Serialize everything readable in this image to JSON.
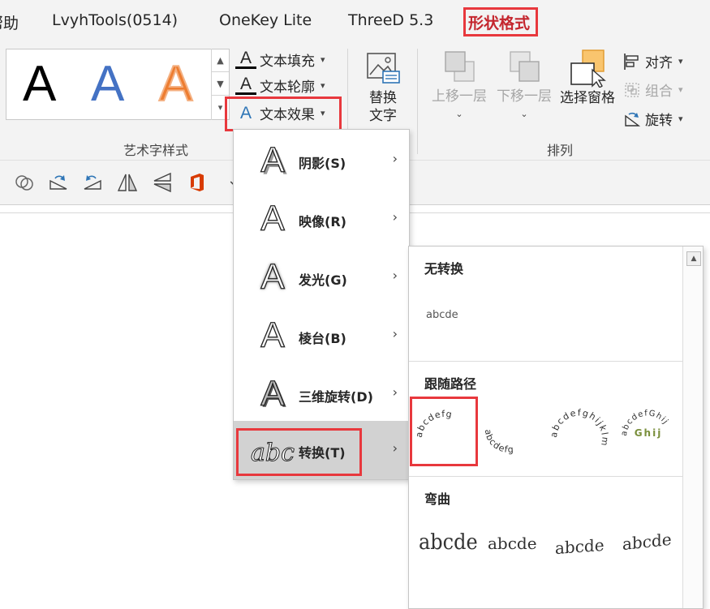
{
  "tabs": [
    {
      "label": "帮助"
    },
    {
      "label": "LvyhTools(0514)"
    },
    {
      "label": "OneKey Lite"
    },
    {
      "label": "ThreeD 5.3"
    },
    {
      "label": "形状格式"
    }
  ],
  "ribbon": {
    "wordart_gallery": {
      "samples": [
        {
          "letter": "A",
          "color": "#000000"
        },
        {
          "letter": "A",
          "color": "#4472c4"
        },
        {
          "letter": "A",
          "color": "#ed7d31"
        }
      ]
    },
    "text_fill": "文本填充",
    "text_outline": "文本轮廓",
    "text_effects": "文本效果",
    "wordart_group_label": "艺术字样式",
    "alt_text_line1": "替换",
    "alt_text_line2": "文字",
    "bring_forward": "上移一层",
    "send_backward": "下移一层",
    "selection_pane": "选择窗格",
    "align": "对齐",
    "group": "组合",
    "rotate": "旋转",
    "arrange_group_label": "排列"
  },
  "text_effects_menu": {
    "items": [
      {
        "label": "阴影(S)",
        "icon": "shadow-A-icon"
      },
      {
        "label": "映像(R)",
        "icon": "reflection-A-icon"
      },
      {
        "label": "发光(G)",
        "icon": "glow-A-icon"
      },
      {
        "label": "棱台(B)",
        "icon": "bevel-A-icon"
      },
      {
        "label": "三维旋转(D)",
        "icon": "3d-rotation-A-icon"
      },
      {
        "label": "转换(T)",
        "icon": "transform-abc-icon"
      }
    ],
    "transform_icon_text": "abc"
  },
  "transform_menu": {
    "no_transform": {
      "heading": "无转换",
      "sample": "abcde"
    },
    "follow_path": {
      "heading": "跟随路径",
      "samples": [
        {
          "text": "abcdefg",
          "name": "arch-up"
        },
        {
          "text": "abcdefg",
          "name": "arch-down"
        },
        {
          "text": "abcdefghijklm",
          "name": "circle"
        },
        {
          "text": "abcdefGhij",
          "name": "button"
        }
      ]
    },
    "warp": {
      "heading": "弯曲",
      "samples": [
        "abcde",
        "abcde",
        "abcde",
        "abcde"
      ]
    }
  },
  "colors": {
    "accent_red": "#e8383d",
    "tab_active": "#c4262e"
  }
}
